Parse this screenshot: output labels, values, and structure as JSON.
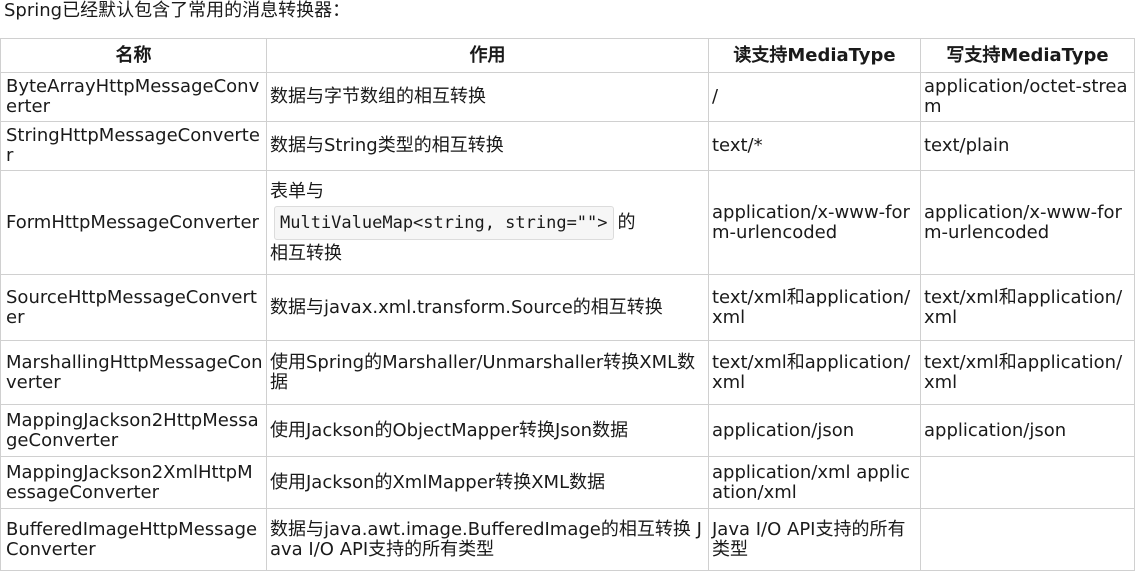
{
  "intro": "Spring已经默认包含了常用的消息转换器：",
  "headers": [
    "名称",
    "作用",
    "读支持MediaType",
    "写支持MediaType"
  ],
  "rows": [
    {
      "name": "ByteArrayHttpMessageConverter",
      "purpose": "数据与字节数组的相互转换",
      "read": "/",
      "write": "application/octet-stream"
    },
    {
      "name": "StringHttpMessageConverter",
      "purpose": "数据与String类型的相互转换",
      "read": "text/*",
      "write": "text/plain"
    },
    {
      "name": "FormHttpMessageConverter",
      "purpose_before": "表单与",
      "purpose_code": "MultiValueMap<string, string=\"\">",
      "purpose_after": "的",
      "purpose_tail": "相互转换",
      "read": "application/x-www-form-urlencoded",
      "write": "application/x-www-form-urlencoded"
    },
    {
      "name": "SourceHttpMessageConverter",
      "purpose": "数据与javax.xml.transform.Source的相互转换",
      "read": "text/xml和application/xml",
      "write": "text/xml和application/xml"
    },
    {
      "name": "MarshallingHttpMessageConverter",
      "purpose": "使用Spring的Marshaller/Unmarshaller转换XML数据",
      "read": "text/xml和application/xml",
      "write": "text/xml和application/xml"
    },
    {
      "name": "MappingJackson2HttpMessageConverter",
      "purpose": "使用Jackson的ObjectMapper转换Json数据",
      "read": "application/json",
      "write": "application/json"
    },
    {
      "name": "MappingJackson2XmlHttpMessageConverter",
      "purpose": "使用Jackson的XmlMapper转换XML数据",
      "read": "application/xml application/xml",
      "write": ""
    },
    {
      "name": "BufferedImageHttpMessageConverter",
      "purpose": "数据与java.awt.image.BufferedImage的相互转换 Java I/O API支持的所有类型",
      "read": "Java I/O API支持的所有类型",
      "write": ""
    }
  ]
}
